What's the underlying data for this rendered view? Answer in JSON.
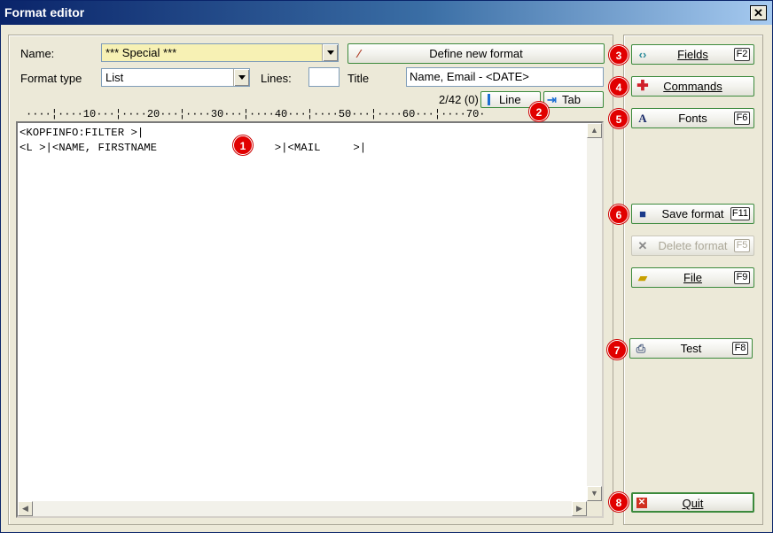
{
  "window": {
    "title": "Format editor",
    "close_glyph": "✕"
  },
  "form": {
    "name_label": "Name:",
    "name_value": "*** Special ***",
    "format_type_label": "Format type",
    "format_type_value": "List",
    "lines_label": "Lines:",
    "lines_value": "",
    "title_label": "Title",
    "title_value": "Name, Email - <DATE>"
  },
  "define_button": {
    "label": "Define new format",
    "icon": "wand-icon"
  },
  "position": {
    "text": "2/42 (0)"
  },
  "line_button": {
    "label": "Line",
    "icon": "cursor-line-icon"
  },
  "tab_button": {
    "label": "Tab",
    "icon": "tab-arrow-icon"
  },
  "ruler": {
    "text": "····¦····10···¦····20···¦····30···¦····40···¦····50···¦····60···¦····70·"
  },
  "editor": {
    "lines": [
      "<KOPFINFO:FILTER >|",
      "<L >|<NAME, FIRSTNAME                  >|<MAIL     >|"
    ]
  },
  "side_buttons": [
    {
      "label": "Fields",
      "key": "F2",
      "icon": "fields-icon",
      "enabled": true
    },
    {
      "label": "Commands",
      "key": "",
      "icon": "plus-icon",
      "enabled": true
    },
    {
      "label": "Fonts",
      "key": "F6",
      "icon": "font-icon",
      "enabled": true
    },
    {
      "label": "Save format",
      "key": "F11",
      "icon": "save-icon",
      "enabled": true
    },
    {
      "label": "Delete format",
      "key": "F5",
      "icon": "delete-icon",
      "enabled": false
    },
    {
      "label": "File",
      "key": "F9",
      "icon": "folder-icon",
      "enabled": true
    },
    {
      "label": "Test",
      "key": "F8",
      "icon": "printer-icon",
      "enabled": true
    },
    {
      "label": "Quit",
      "key": "",
      "icon": "quit-icon",
      "enabled": true
    }
  ],
  "badges": [
    "1",
    "2",
    "3",
    "4",
    "5",
    "6",
    "7",
    "8"
  ],
  "colors": {
    "titlebar": "#0a246a",
    "badge": "#e10000",
    "name_field_bg": "#f7f1b4",
    "button_border": "#3c8a3c"
  }
}
